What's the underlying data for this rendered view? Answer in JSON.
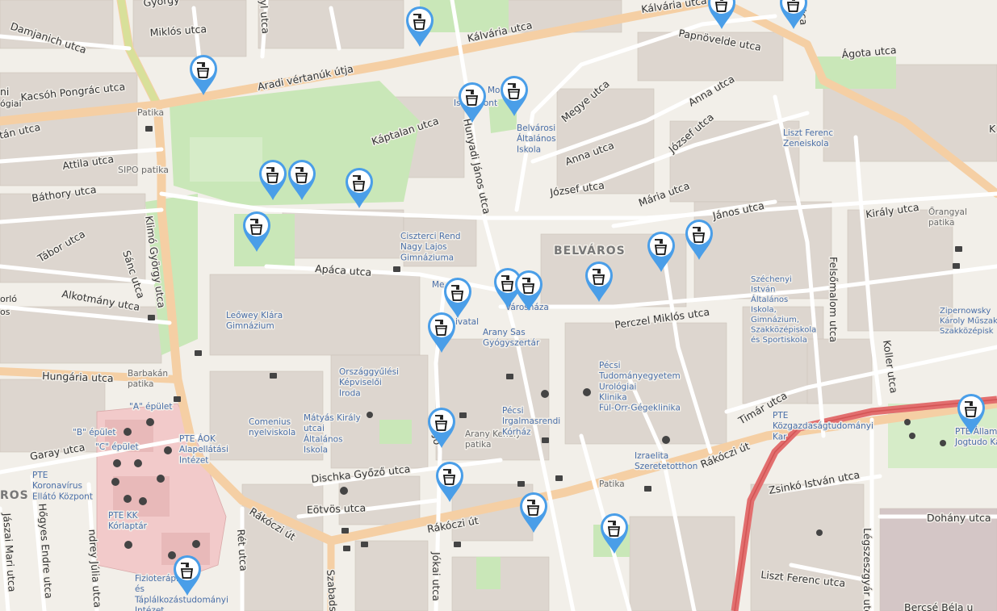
{
  "map": {
    "district": "BELVÁROS",
    "district_left": "ROS",
    "streets": [
      {
        "id": "kalvaria-utca",
        "text": "Kálvária utca"
      },
      {
        "id": "kalvaria-utca-2",
        "text": "Kálvária utca"
      },
      {
        "id": "papnovelde-utca",
        "text": "Papnövelde utca"
      },
      {
        "id": "agota-utca",
        "text": "Ágota utca"
      },
      {
        "id": "aradi-vertanuk-utja",
        "text": "Aradi vértanúk útja"
      },
      {
        "id": "miklos-utca",
        "text": "Miklós utca"
      },
      {
        "id": "damjanich-utca",
        "text": "Damjanich utca"
      },
      {
        "id": "kacsoh-pongrac-utca",
        "text": "Kacsóh Pongrác utca"
      },
      {
        "id": "attila-utca",
        "text": "Attila utca"
      },
      {
        "id": "bathory-utca",
        "text": "Báthory utca"
      },
      {
        "id": "tabor-utca",
        "text": "Tábor utca"
      },
      {
        "id": "alkotmany-utca",
        "text": "Alkotmány utca"
      },
      {
        "id": "hungaria-utca",
        "text": "Hungária utca"
      },
      {
        "id": "garay-utca",
        "text": "Garay utca"
      },
      {
        "id": "kaptalan-utca",
        "text": "Káptalan utca"
      },
      {
        "id": "hunyadi-janos-utca",
        "text": "Hunyadi János utca"
      },
      {
        "id": "megye-utca",
        "text": "Megye utca"
      },
      {
        "id": "anna-utca",
        "text": "Anna utca"
      },
      {
        "id": "anna-utca-2",
        "text": "Anna utca"
      },
      {
        "id": "jozsef-utca",
        "text": "József utca"
      },
      {
        "id": "jozsef-utca-2",
        "text": "József utca"
      },
      {
        "id": "maria-utca",
        "text": "Mária utca"
      },
      {
        "id": "janos-utca",
        "text": "János utca"
      },
      {
        "id": "kiraly-utca",
        "text": "Király utca"
      },
      {
        "id": "apaca-utca",
        "text": "Apáca utca"
      },
      {
        "id": "perczel-miklos-utca",
        "text": "Perczel Miklós utca"
      },
      {
        "id": "felsomalom-utca",
        "text": "Felsőmalom utca"
      },
      {
        "id": "koller-utca",
        "text": "Koller utca"
      },
      {
        "id": "timar-utca",
        "text": "Timár utca"
      },
      {
        "id": "rakoczi-ut-1",
        "text": "Rákóczi út"
      },
      {
        "id": "rakoczi-ut-2",
        "text": "Rákóczi út"
      },
      {
        "id": "rakoczi-ut-3",
        "text": "Rákóczi út"
      },
      {
        "id": "dischka-gyozo-utca",
        "text": "Dischka Győző utca"
      },
      {
        "id": "eotvos-utca",
        "text": "Eötvös utca"
      },
      {
        "id": "zsinko-istvan-utca",
        "text": "Zsinkó István utca"
      },
      {
        "id": "dohany-utca",
        "text": "Dohány utca"
      },
      {
        "id": "liszt-ferenc-utca",
        "text": "Liszt Ferenc utca"
      },
      {
        "id": "legszeszgyar-utca",
        "text": "Légszeszgyár utca"
      },
      {
        "id": "klimo-gyorgy-utca",
        "text": "Klimó György utca"
      },
      {
        "id": "sanc-utca",
        "text": "Sánc utca"
      },
      {
        "id": "hoges-endre-utca",
        "text": "Hőgyes Endre utca"
      },
      {
        "id": "ret-utca",
        "text": "Rét utca"
      },
      {
        "id": "jokai-utca",
        "text": "Jókai utca"
      },
      {
        "id": "szabadsag",
        "text": "Szabads"
      },
      {
        "id": "jo",
        "text": "Jó"
      },
      {
        "id": "gyorgy",
        "text": "György"
      },
      {
        "id": "yl-utca",
        "text": "yl utca"
      },
      {
        "id": "tca",
        "text": "tca"
      },
      {
        "id": "ndrey-julia-utca",
        "text": "ndrey Júlia utca"
      },
      {
        "id": "jaszai-mari-utca",
        "text": "Jászai Mari utca"
      },
      {
        "id": "tan-utca",
        "text": "tán utca"
      },
      {
        "id": "kalvaria-k",
        "text": "K"
      },
      {
        "id": "kacsoh-left",
        "text": "ni"
      },
      {
        "id": "ogiai",
        "text": "ógiai"
      },
      {
        "id": "orlo",
        "text": "orló"
      },
      {
        "id": "os",
        "text": "os"
      },
      {
        "id": "bercse-bela",
        "text": "Bercsé Béla u"
      }
    ],
    "pois": [
      {
        "id": "patika-1",
        "text": "Patika"
      },
      {
        "id": "sipo-patika",
        "text": "SIPO patika"
      },
      {
        "id": "ciszterci",
        "text": "Ciszterci Rend Nagy Lajos Gimnáziuma"
      },
      {
        "id": "belvarosi-iskola",
        "text": "Belvárosi Általános Iskola"
      },
      {
        "id": "liszt-zeneiskola",
        "text": "Liszt Ferenc Zeneiskola"
      },
      {
        "id": "orangyal-patika",
        "text": "Őrangyal patika"
      },
      {
        "id": "leowey",
        "text": "Leőwey Klára Gimnázium"
      },
      {
        "id": "varoshaza",
        "text": "Városháza"
      },
      {
        "id": "arany-sas",
        "text": "Arany Sas Gyógyszertár"
      },
      {
        "id": "szechenyi",
        "text": "Széchenyi István Általános Iskola, Gimnázium, Szakközépiskola és Sportiskola"
      },
      {
        "id": "zipernowsky",
        "text": "Zipernowsky Károly Műszaki Szakközépisk"
      },
      {
        "id": "pte-urologia",
        "text": "Pécsi Tudományegyetem Urológiai Klinika Fül-Orr-Gégeklinika"
      },
      {
        "id": "barbakan-patika",
        "text": "Barbakán patika"
      },
      {
        "id": "a-epulet",
        "text": "\"A\" épület"
      },
      {
        "id": "b-epulet",
        "text": "\"B\" épület"
      },
      {
        "id": "c-epulet",
        "text": "\"C\" épület"
      },
      {
        "id": "pte-aok",
        "text": "PTE ÁOK Alapellátási Intézet"
      },
      {
        "id": "koronavirus",
        "text": "PTE Koronavírus Ellátó Központ"
      },
      {
        "id": "pte-kk-korlaptar",
        "text": "PTE KK Kórlaptár"
      },
      {
        "id": "orszaggyulesi",
        "text": "Országgyűlési Képviselői Iroda"
      },
      {
        "id": "comenius",
        "text": "Comenius nyelviskola"
      },
      {
        "id": "matyas-kiraly",
        "text": "Mátyás Király utcai Általános Iskola"
      },
      {
        "id": "arany-kehely",
        "text": "Arany Kehely patika"
      },
      {
        "id": "irgalmasrendi",
        "text": "Pécsi Irgalmasrendi Kórház"
      },
      {
        "id": "izraelita",
        "text": "Izraelita Szeretetotthon"
      },
      {
        "id": "patika-2",
        "text": "Patika"
      },
      {
        "id": "pte-kozgazdasag",
        "text": "PTE Közgazdaságtudományi Kar"
      },
      {
        "id": "pte-allam",
        "text": "PTE Állam- és Jogtudo Kar"
      },
      {
        "id": "fizioterapias",
        "text": "Fizioterápiás és Táplálkozástudományi Intézet"
      },
      {
        "id": "mo",
        "text": "Mo"
      },
      {
        "id": "iskozpo",
        "text": "Is  Központ"
      },
      {
        "id": "me-za",
        "text": "Me       za"
      },
      {
        "id": "hivatal",
        "text": "ivatal"
      }
    ],
    "markers": [
      {
        "id": "marker-01",
        "label": "drinking-water"
      },
      {
        "id": "marker-02",
        "label": "drinking-water"
      },
      {
        "id": "marker-03",
        "label": "drinking-water"
      },
      {
        "id": "marker-04",
        "label": "drinking-water"
      },
      {
        "id": "marker-05",
        "label": "drinking-water"
      },
      {
        "id": "marker-06",
        "label": "drinking-water"
      },
      {
        "id": "marker-07",
        "label": "drinking-water"
      },
      {
        "id": "marker-08",
        "label": "drinking-water"
      },
      {
        "id": "marker-09",
        "label": "drinking-water"
      },
      {
        "id": "marker-10",
        "label": "drinking-water"
      },
      {
        "id": "marker-11",
        "label": "drinking-water"
      },
      {
        "id": "marker-12",
        "label": "drinking-water"
      },
      {
        "id": "marker-13",
        "label": "drinking-water"
      },
      {
        "id": "marker-14",
        "label": "drinking-water"
      },
      {
        "id": "marker-15",
        "label": "drinking-water"
      },
      {
        "id": "marker-16",
        "label": "drinking-water"
      },
      {
        "id": "marker-17",
        "label": "drinking-water"
      },
      {
        "id": "marker-18",
        "label": "drinking-water"
      },
      {
        "id": "marker-19",
        "label": "drinking-water"
      },
      {
        "id": "marker-20",
        "label": "drinking-water"
      },
      {
        "id": "marker-21",
        "label": "drinking-water"
      },
      {
        "id": "marker-22",
        "label": "drinking-water"
      },
      {
        "id": "marker-23",
        "label": "drinking-water"
      },
      {
        "id": "marker-24",
        "label": "drinking-water"
      }
    ],
    "colors": {
      "background": "#f2efe9",
      "building": "#d9d0c9",
      "park": "#c8facc",
      "green": "#add19e",
      "major_road": "#fcd6a4",
      "primary_road": "#f7c6a0",
      "railway_red": "#e46c6c",
      "hospital": "#f0cccc",
      "marker": "#4a9ee8"
    }
  }
}
